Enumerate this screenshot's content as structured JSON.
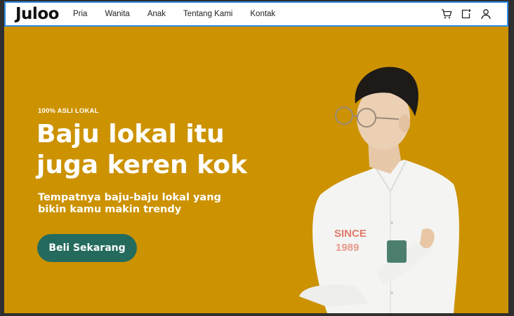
{
  "brand": {
    "logo_text": "Juloo"
  },
  "nav": {
    "links": [
      "Pria",
      "Wanita",
      "Anak",
      "Tentang Kami",
      "Kontak"
    ],
    "icons": [
      "cart-icon",
      "wishlist-icon",
      "user-icon"
    ]
  },
  "hero": {
    "eyebrow": "100% ASLI LOKAL",
    "headline": "Baju lokal itu juga keren kok",
    "subheadline": "Tempatnya baju-baju lokal yang bikin kamu makin trendy",
    "cta_label": "Beli Sekarang",
    "shirt_print": [
      "SINCE",
      "1989"
    ]
  },
  "colors": {
    "hero_background": "#cc9200",
    "cta_background": "#246b5e",
    "nav_background": "#ffffff",
    "selection_outline": "#2d8be6"
  }
}
